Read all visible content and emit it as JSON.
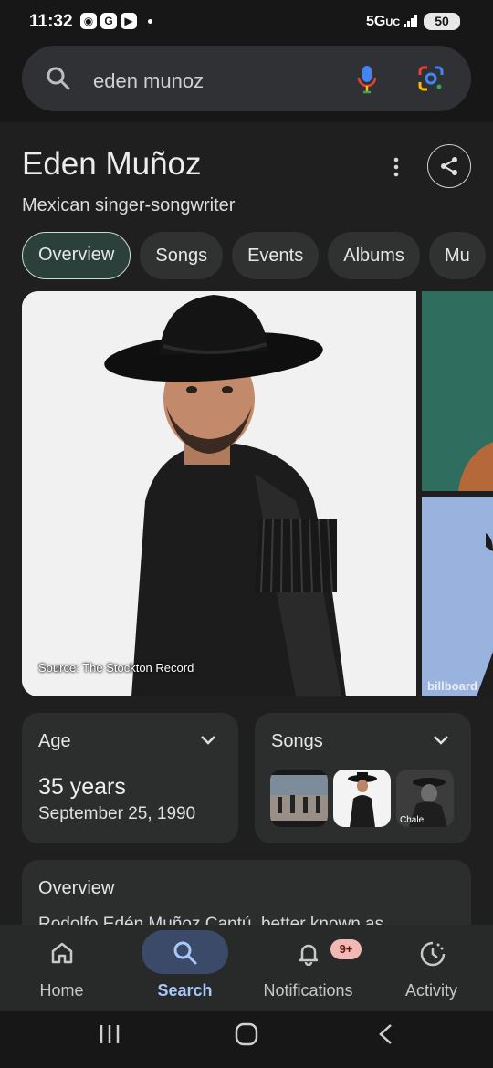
{
  "status_bar": {
    "time": "11:32",
    "network": "5G",
    "network_suffix": "UC",
    "battery": "50",
    "app_icons": [
      "G",
      "▶"
    ]
  },
  "search": {
    "query": "eden munoz"
  },
  "panel": {
    "title": "Eden Muñoz",
    "subtitle": "Mexican singer-songwriter"
  },
  "tabs": [
    {
      "label": "Overview",
      "active": true
    },
    {
      "label": "Songs",
      "active": false
    },
    {
      "label": "Events",
      "active": false
    },
    {
      "label": "Albums",
      "active": false
    },
    {
      "label": "Mu",
      "active": false
    }
  ],
  "images": {
    "main_source": "Source: The Stockton Record",
    "side_bottom_label": "billboard"
  },
  "age_card": {
    "label": "Age",
    "value": "35 years",
    "date": "September 25, 1990"
  },
  "songs_card": {
    "label": "Songs",
    "thumb_caption": "Chale"
  },
  "overview_card": {
    "title": "Overview",
    "text": "Rodolfo Edén Muñoz Cantú, better known as"
  },
  "bottom_nav": [
    {
      "label": "Home",
      "icon": "home-icon",
      "active": false
    },
    {
      "label": "Search",
      "icon": "search-icon",
      "active": true
    },
    {
      "label": "Notifications",
      "icon": "bell-icon",
      "active": false,
      "badge": "9+"
    },
    {
      "label": "Activity",
      "icon": "activity-icon",
      "active": false
    }
  ],
  "colors": {
    "background": "#1f1f1f",
    "active_tab": "#2b403b",
    "active_nav": "#3c4a69",
    "active_nav_text": "#a8c7fa",
    "badge": "#f2b8b5"
  }
}
